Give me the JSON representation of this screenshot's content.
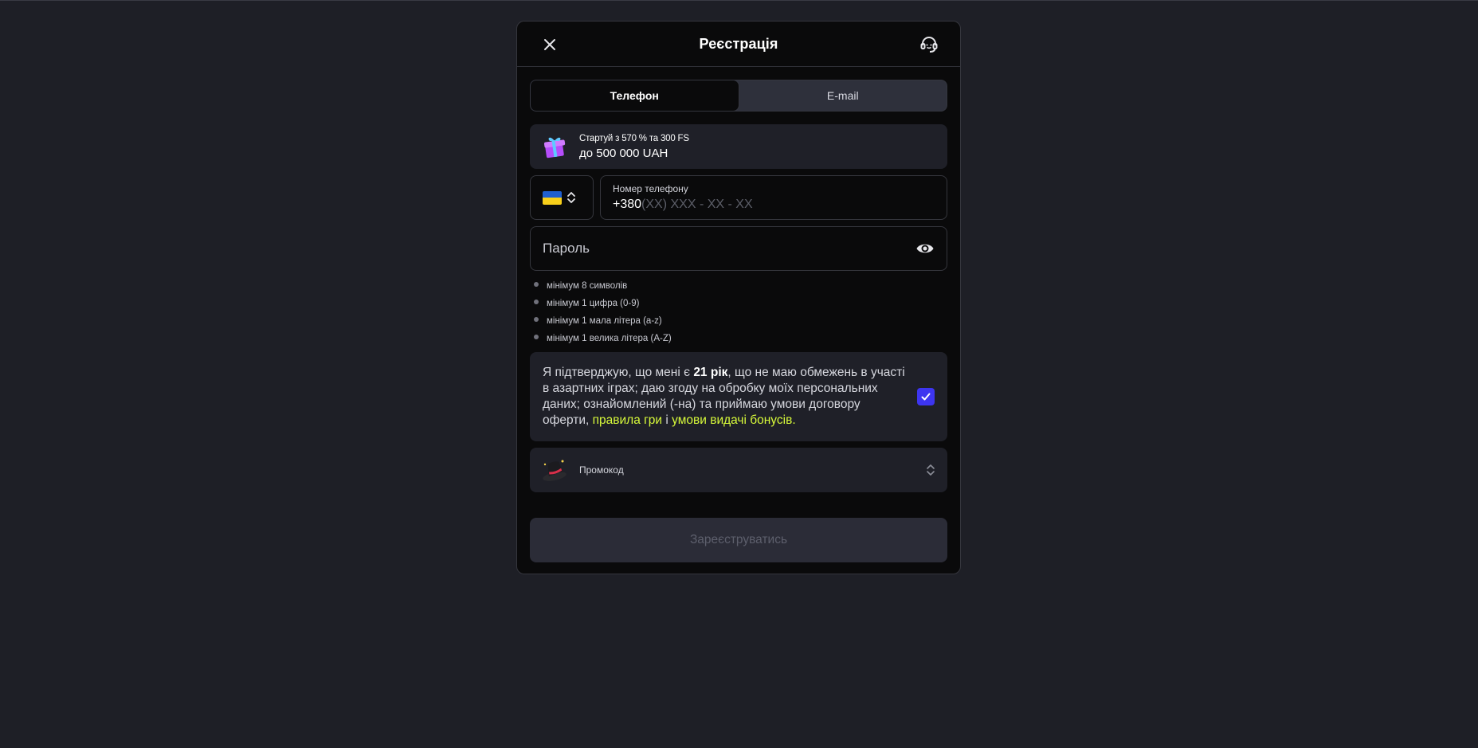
{
  "modal": {
    "title": "Реєстрація",
    "close_icon": "close-icon",
    "support_icon": "headset-support-icon"
  },
  "tabs": [
    {
      "label": "Телефон",
      "active": true
    },
    {
      "label": "E-mail",
      "active": false
    }
  ],
  "bonus": {
    "icon": "gift-icon",
    "line1": "Стартуй з 570 % та 300 FS",
    "line2": "до 500 000 UAH"
  },
  "phone": {
    "country_flag": "ukraine-flag-icon",
    "label": "Номер телефону",
    "prefix": "+380",
    "mask": "(XX) XXX - XX - XX"
  },
  "password": {
    "placeholder": "Пароль",
    "toggle_icon": "eye-icon"
  },
  "password_rules": [
    "мінімум 8 символів",
    "мінімум 1 цифра (0-9)",
    "мінімум 1 мала літера (a-z)",
    "мінімум 1 велика літера (A-Z)"
  ],
  "consent": {
    "text_before": "Я підтверджую, що мені є ",
    "age": "21 рік",
    "text_middle": ", що не маю обмежень в участі в азартних іграх; даю згоду на обробку моїх персональних даних; ознайомлений (-на) та приймаю умови договору оферти, ",
    "link1": "правила гри",
    "conj": " і ",
    "link2": "умови видачі бонусів",
    "end": ".",
    "checked": true,
    "accent_color": "#3d35f0",
    "link_color": "#d7f93a"
  },
  "promo": {
    "icon": "magic-hat-icon",
    "label": "Промокод"
  },
  "submit": {
    "label": "Зареєструватись"
  }
}
